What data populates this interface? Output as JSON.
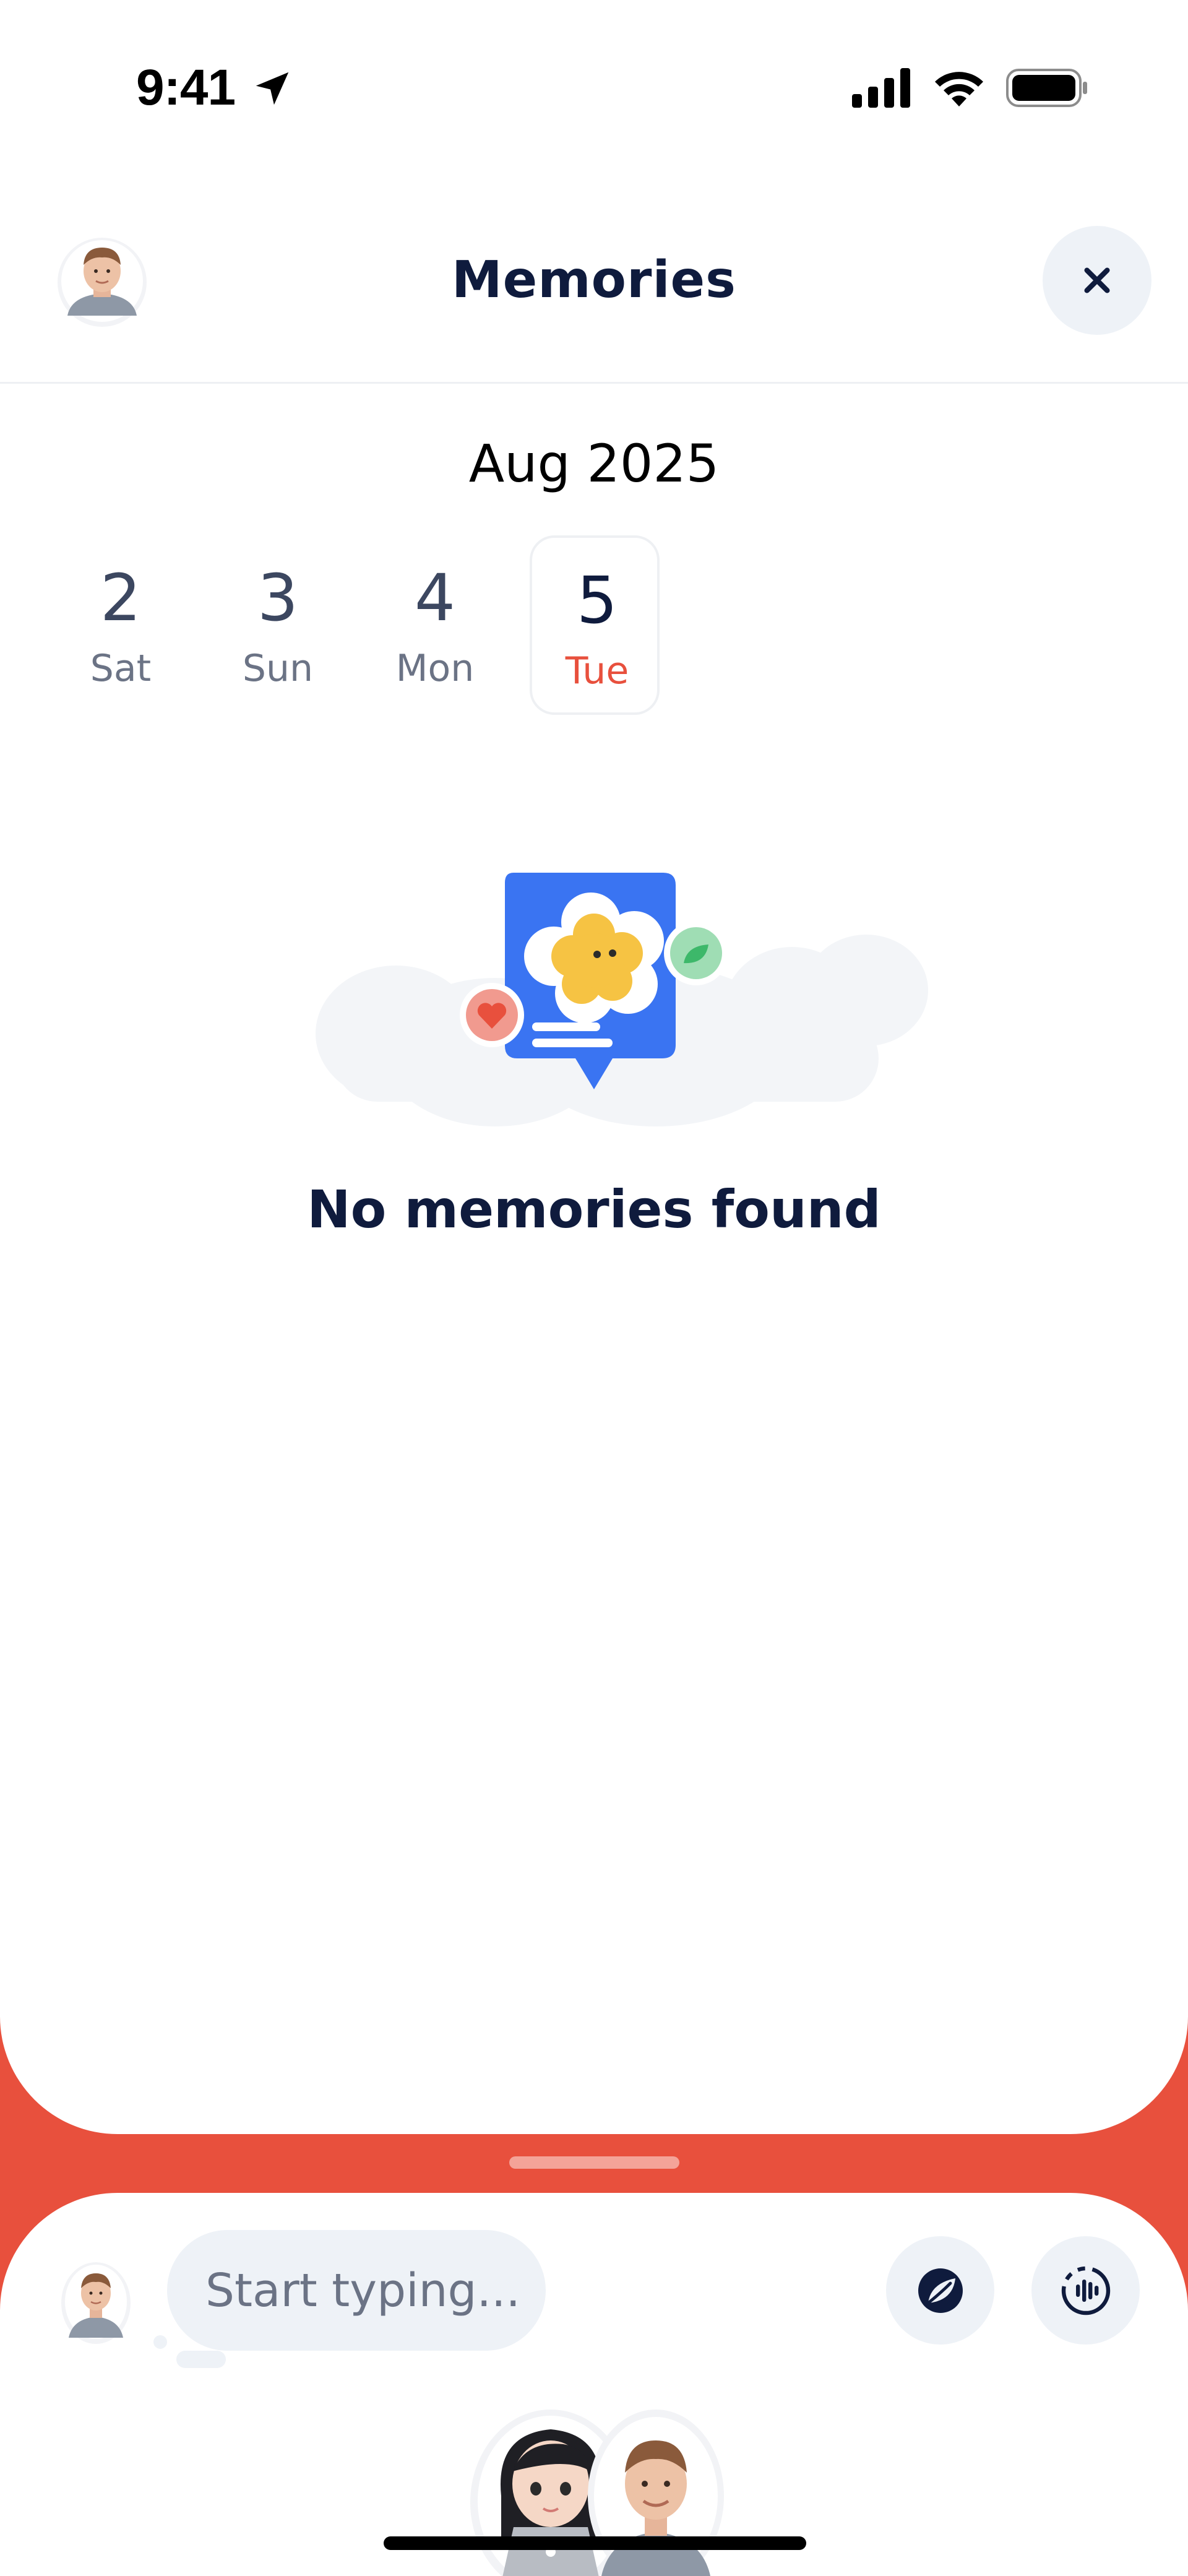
{
  "status_bar": {
    "time": "9:41",
    "icons": [
      "location-arrow-icon",
      "cellular-signal-icon",
      "wifi-icon",
      "battery-icon"
    ]
  },
  "header": {
    "title": "Memories",
    "avatar_icon": "avatar",
    "close_icon": "close-icon"
  },
  "calendar": {
    "month": "Aug 2025",
    "days": [
      {
        "num": "2",
        "name": "Sat",
        "selected": false
      },
      {
        "num": "3",
        "name": "Sun",
        "selected": false
      },
      {
        "num": "4",
        "name": "Mon",
        "selected": false
      },
      {
        "num": "5",
        "name": "Tue",
        "selected": true
      }
    ]
  },
  "empty_state": {
    "title": "No memories found"
  },
  "composer": {
    "placeholder": "Start typing...",
    "leaf_icon": "leaf-icon",
    "voice_icon": "voice-wave-icon"
  },
  "colors": {
    "accent": "#E8503D",
    "title": "#0F1B3D",
    "pill": "#EEF2F7",
    "illustration_blue": "#3A74F2",
    "illustration_yellow": "#F6C343"
  }
}
